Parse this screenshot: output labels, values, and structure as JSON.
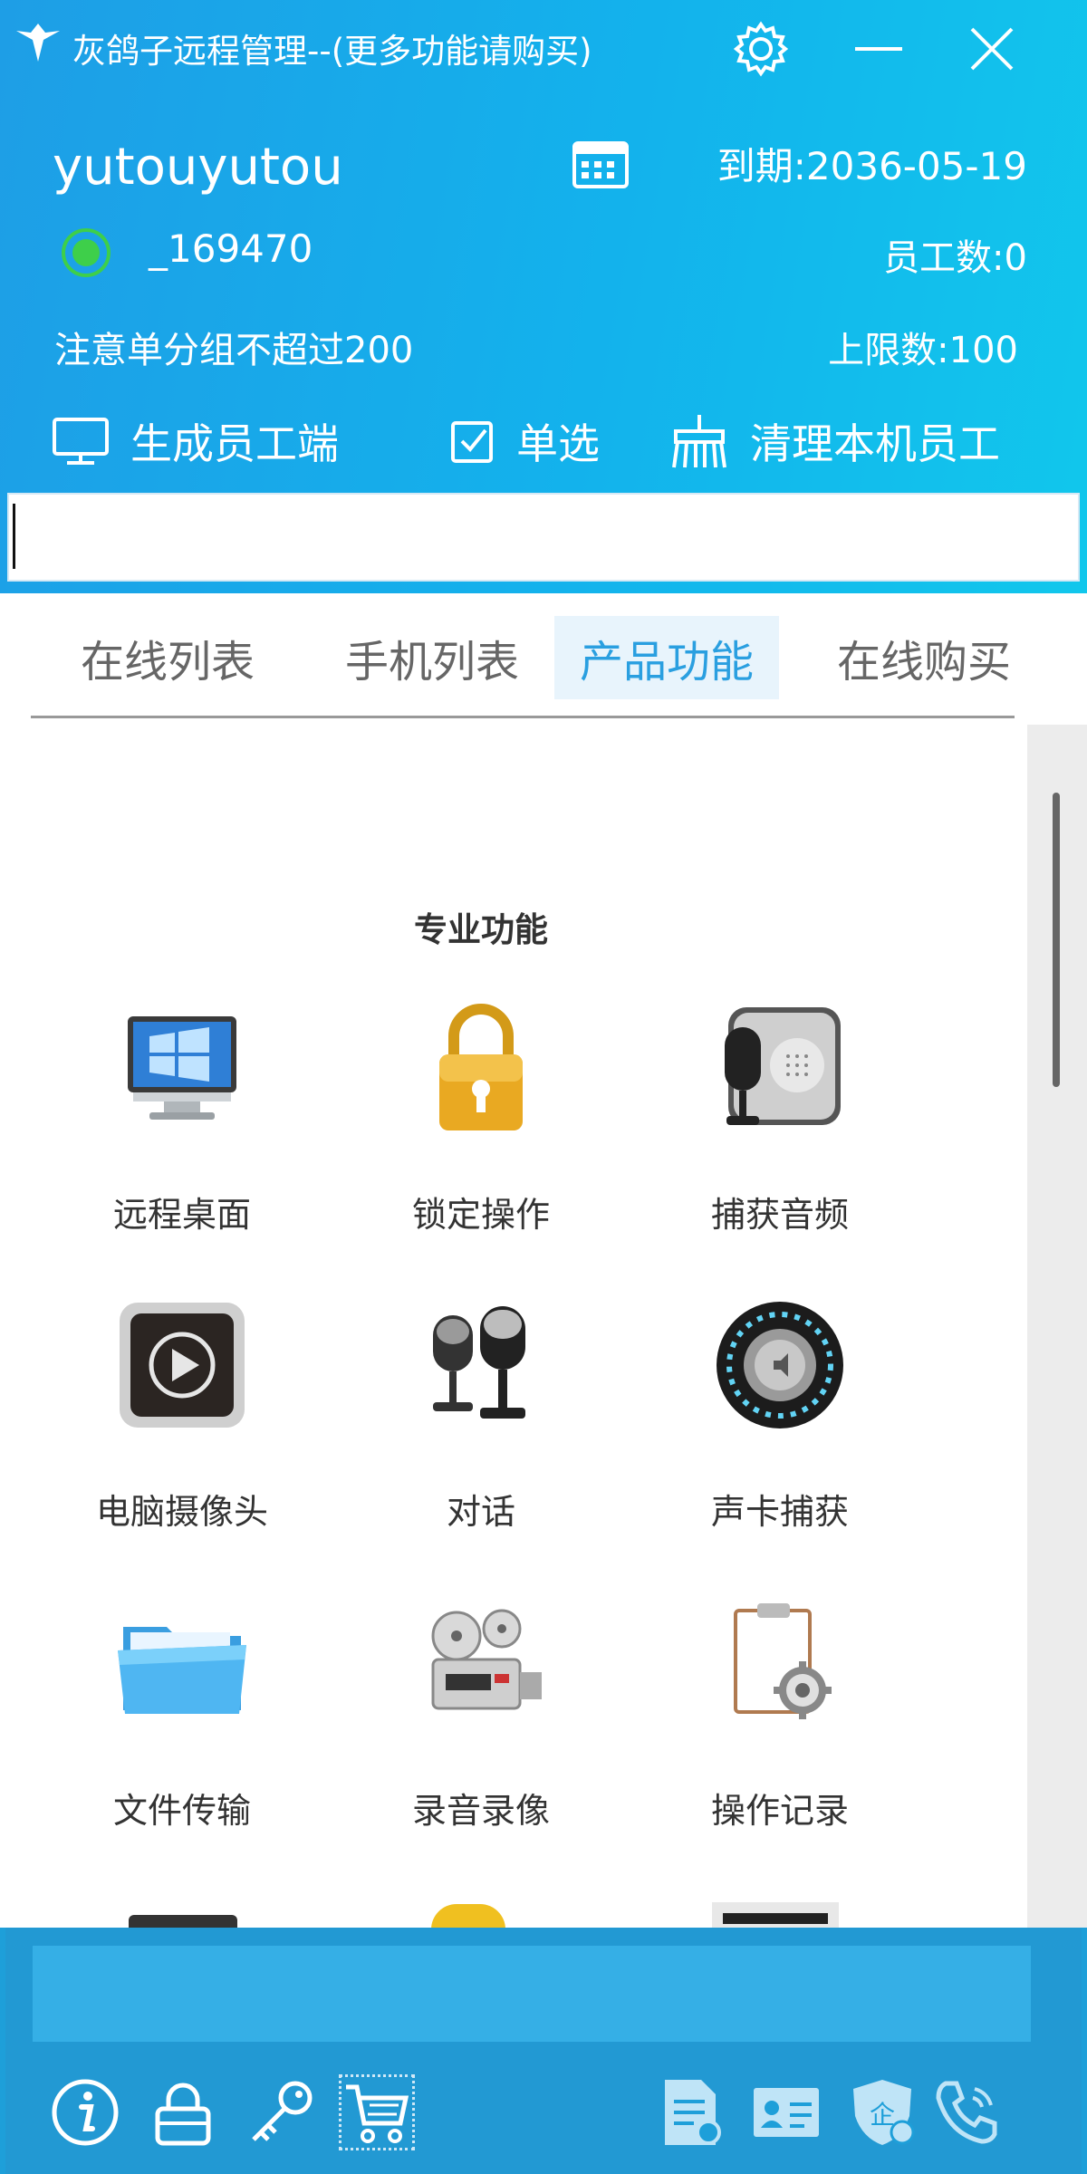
{
  "window": {
    "title": "灰鸽子远程管理--(更多功能请购买)"
  },
  "account": {
    "username": "yutouyutou",
    "user_id": "_169470",
    "expiry": "到期:2036-05-19",
    "employee_count": "员工数:0",
    "group_note": "注意单分组不超过200",
    "limit": "上限数:100"
  },
  "actions": {
    "generate": "生成员工端",
    "single_select": "单选",
    "clean": "清理本机员工"
  },
  "search": {
    "value": "",
    "placeholder": ""
  },
  "tabs": [
    {
      "label": "在线列表",
      "active": false
    },
    {
      "label": "手机列表",
      "active": false
    },
    {
      "label": "产品功能",
      "active": true
    },
    {
      "label": "在线购买",
      "active": false
    }
  ],
  "section": {
    "title": "专业功能"
  },
  "features": [
    {
      "label": "远程桌面",
      "icon": "monitor-icon"
    },
    {
      "label": "锁定操作",
      "icon": "padlock-icon"
    },
    {
      "label": "捕获音频",
      "icon": "microphone-icon"
    },
    {
      "label": "电脑摄像头",
      "icon": "play-icon"
    },
    {
      "label": "对话",
      "icon": "dual-microphone-icon"
    },
    {
      "label": "声卡捕获",
      "icon": "speaker-knob-icon"
    },
    {
      "label": "文件传输",
      "icon": "folder-icon"
    },
    {
      "label": "录音录像",
      "icon": "film-projector-icon"
    },
    {
      "label": "操作记录",
      "icon": "clipboard-gear-icon"
    }
  ],
  "footer_icons": [
    "info-icon",
    "lock-icon",
    "key-icon",
    "cart-icon",
    "document-icon",
    "id-card-icon",
    "shield-icon",
    "phone-icon"
  ],
  "colors": {
    "header_start": "#1e9ee6",
    "header_end": "#11c7ec",
    "online": "#3ecf4a",
    "tab_active": "#2a9fe0"
  }
}
